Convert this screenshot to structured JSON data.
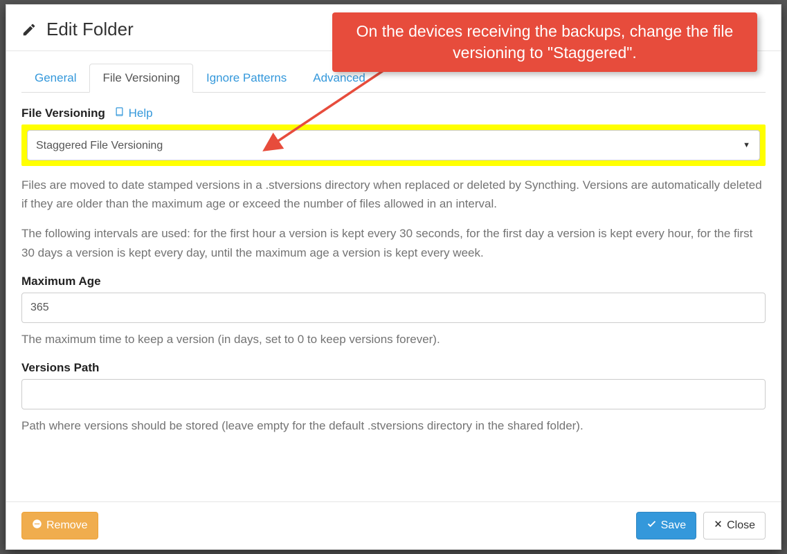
{
  "header": {
    "title": "Edit Folder"
  },
  "tabs": {
    "general": "General",
    "file_versioning": "File Versioning",
    "ignore_patterns": "Ignore Patterns",
    "advanced": "Advanced"
  },
  "file_versioning": {
    "label": "File Versioning",
    "help_label": "Help",
    "select_value": "Staggered File Versioning",
    "desc1": "Files are moved to date stamped versions in a .stversions directory when replaced or deleted by Syncthing. Versions are automatically deleted if they are older than the maximum age or exceed the number of files allowed in an interval.",
    "desc2": "The following intervals are used: for the first hour a version is kept every 30 seconds, for the first day a version is kept every hour, for the first 30 days a version is kept every day, until the maximum age a version is kept every week."
  },
  "max_age": {
    "label": "Maximum Age",
    "value": "365",
    "help": "The maximum time to keep a version (in days, set to 0 to keep versions forever)."
  },
  "versions_path": {
    "label": "Versions Path",
    "value": "",
    "help": "Path where versions should be stored (leave empty for the default .stversions directory in the shared folder)."
  },
  "footer": {
    "remove": "Remove",
    "save": "Save",
    "close": "Close"
  },
  "callout": {
    "text": "On the devices receiving the backups, change the file versioning to \"Staggered\"."
  }
}
